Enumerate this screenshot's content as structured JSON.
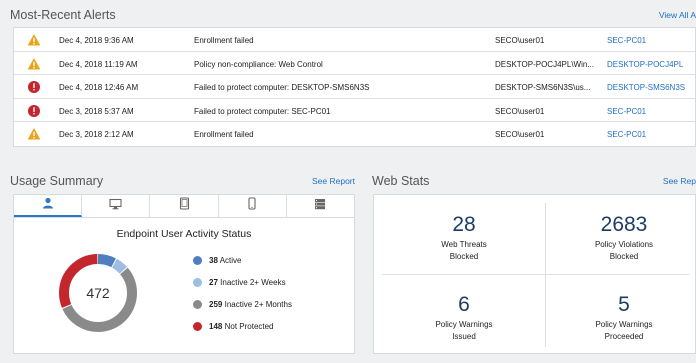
{
  "alerts": {
    "title": "Most-Recent Alerts",
    "view_all": "View All A",
    "rows": [
      {
        "severity": "warning",
        "date": "Dec 4, 2018 9:36 AM",
        "description": "Enrollment failed",
        "user": "SECO\\user01",
        "host": "SEC-PC01"
      },
      {
        "severity": "warning",
        "date": "Dec 4, 2018 11:19 AM",
        "description": "Policy non-compliance: Web Control",
        "user": "DESKTOP-POCJ4PL\\Win...",
        "host": "DESKTOP-POCJ4PL"
      },
      {
        "severity": "critical",
        "date": "Dec 4, 2018 12:46 AM",
        "description": "Failed to protect computer: DESKTOP-SMS6N3S",
        "user": "DESKTOP-SMS6N3S\\us...",
        "host": "DESKTOP-SMS6N3S"
      },
      {
        "severity": "critical",
        "date": "Dec 3, 2018 5:37 AM",
        "description": "Failed to protect computer: SEC-PC01",
        "user": "SECO\\user01",
        "host": "SEC-PC01"
      },
      {
        "severity": "warning",
        "date": "Dec 3, 2018 2:12 AM",
        "description": "Enrollment failed",
        "user": "SECO\\user01",
        "host": "SEC-PC01"
      }
    ]
  },
  "usage": {
    "title": "Usage Summary",
    "see_report": "See Report",
    "tabs": [
      {
        "icon": "user-icon",
        "active": true
      },
      {
        "icon": "desktop-icon",
        "active": false
      },
      {
        "icon": "tablet-icon",
        "active": false
      },
      {
        "icon": "mobile-icon",
        "active": false
      },
      {
        "icon": "server-icon",
        "active": false
      }
    ],
    "panel_title": "Endpoint User Activity Status",
    "total": "472",
    "legend": [
      {
        "value": 38,
        "value_label": "38",
        "label": "Active",
        "color": "#4f7fbf"
      },
      {
        "value": 27,
        "value_label": "27",
        "label": "Inactive 2+ Weeks",
        "color": "#9dbde3"
      },
      {
        "value": 259,
        "value_label": "259",
        "label": "Inactive 2+ Months",
        "color": "#8a8a8a"
      },
      {
        "value": 148,
        "value_label": "148",
        "label": "Not Protected",
        "color": "#c4262e"
      }
    ]
  },
  "web_stats": {
    "title": "Web Stats",
    "see_report": "See Rep",
    "stats": [
      {
        "value": "28",
        "label_line1": "Web Threats",
        "label_line2": "Blocked"
      },
      {
        "value": "2683",
        "label_line1": "Policy Violations",
        "label_line2": "Blocked"
      },
      {
        "value": "6",
        "label_line1": "Policy Warnings",
        "label_line2": "Issued"
      },
      {
        "value": "5",
        "label_line1": "Policy Warnings",
        "label_line2": "Proceeded"
      }
    ]
  },
  "colors": {
    "warning": "#e8a317",
    "critical": "#c4262e",
    "link": "#1f6fc5",
    "accent": "#2b78c5"
  }
}
